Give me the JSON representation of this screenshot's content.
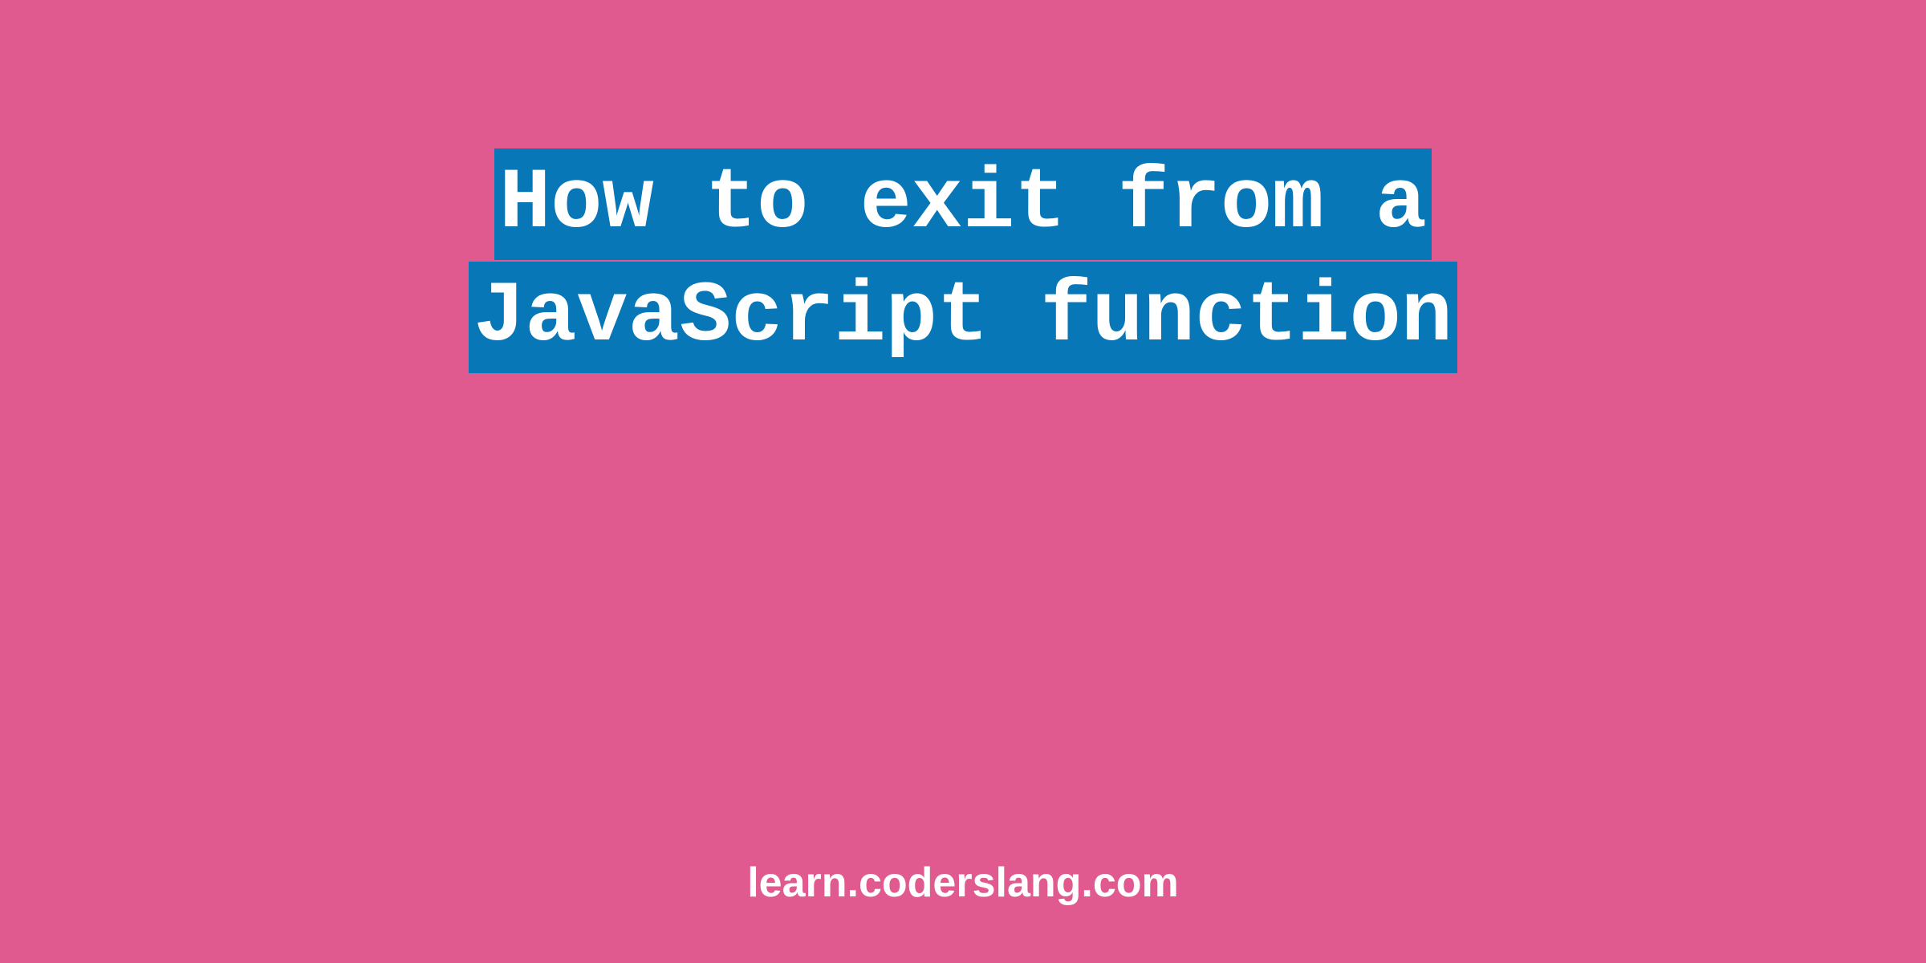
{
  "title": {
    "line1": "How to exit from a",
    "line2": "JavaScript function"
  },
  "footer": {
    "url": "learn.coderslang.com"
  },
  "colors": {
    "background": "#e05a8f",
    "highlight": "#0877b8",
    "text": "#ffffff"
  }
}
